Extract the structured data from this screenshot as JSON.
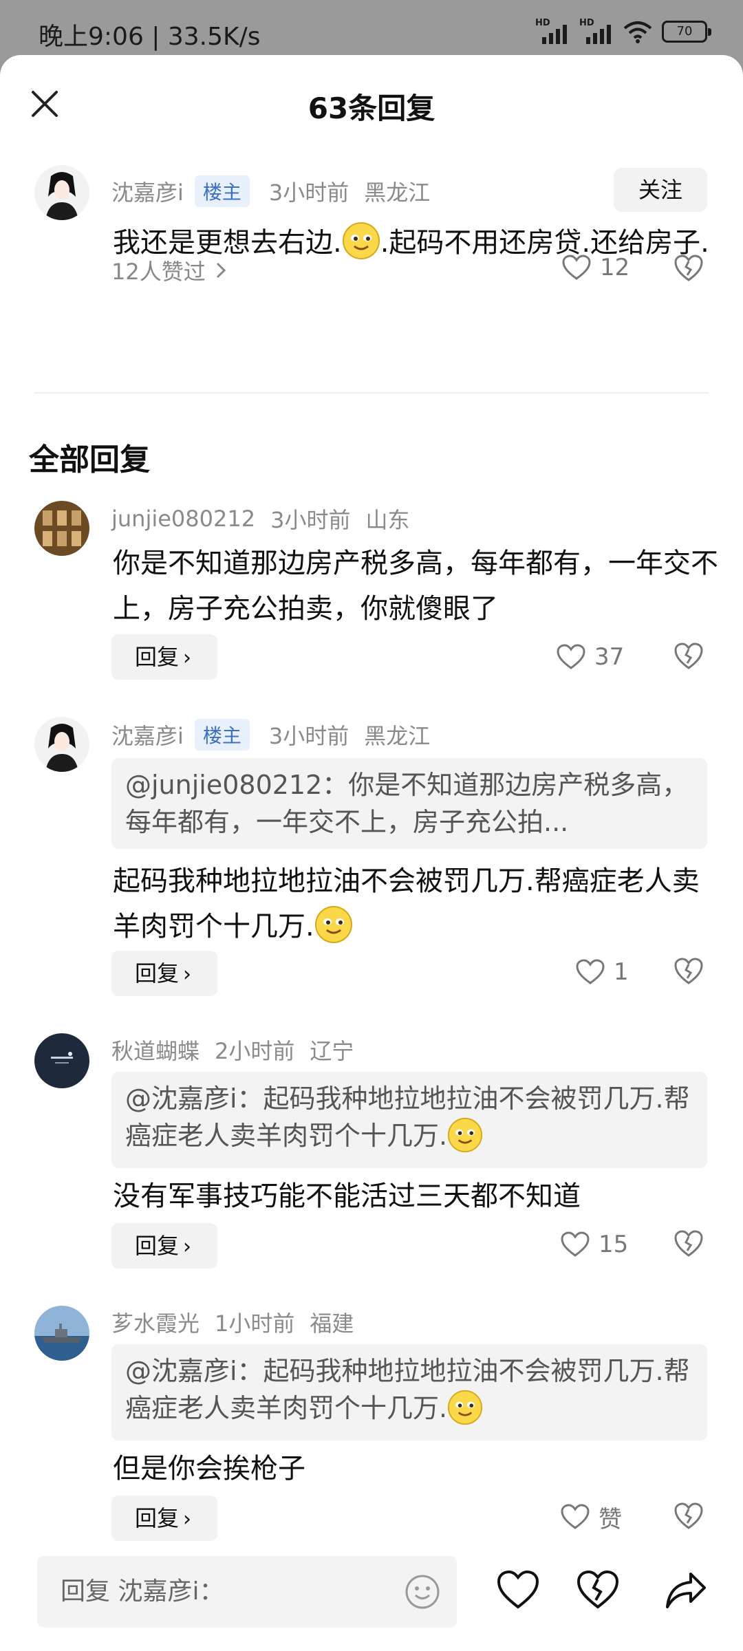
{
  "status": {
    "time": "晚上9:06 | 33.5K/s",
    "sig1": "HD",
    "sig2": "HD",
    "battery": "70"
  },
  "header": {
    "title": "63条回复"
  },
  "main_comment": {
    "author": "沈嘉彦i",
    "badge": "楼主",
    "time": "3小时前",
    "location": "黑龙江",
    "follow_label": "关注",
    "text_a": "我还是更想去右边.",
    "text_b": ".起码不用还房贷.还给房子.",
    "likers": "12人赞过",
    "likes": "12"
  },
  "section_title": "全部回复",
  "replies": [
    {
      "author": "junjie080212",
      "time": "3小时前",
      "location": "山东",
      "text": "你是不知道那边房产税多高，每年都有，一年交不上，房子充公拍卖，你就傻眼了",
      "reply_label": "回复",
      "likes": "37"
    },
    {
      "author": "沈嘉彦i",
      "badge": "楼主",
      "time": "3小时前",
      "location": "黑龙江",
      "quote": "@junjie080212：你是不知道那边房产税多高，每年都有，一年交不上，房子充公拍...",
      "text": "起码我种地拉地拉油不会被罚几万.帮癌症老人卖羊肉罚个十几万.",
      "reply_label": "回复",
      "likes": "1"
    },
    {
      "author": "秋道蝴蝶",
      "time": "2小时前",
      "location": "辽宁",
      "quote": "@沈嘉彦i：起码我种地拉地拉油不会被罚几万.帮癌症老人卖羊肉罚个十几万.",
      "text": "没有军事技巧能不能活过三天都不知道",
      "reply_label": "回复",
      "likes": "15"
    },
    {
      "author": "芗水霞光",
      "time": "1小时前",
      "location": "福建",
      "quote": "@沈嘉彦i：起码我种地拉地拉油不会被罚几万.帮癌症老人卖羊肉罚个十几万.",
      "text": "但是你会挨枪子",
      "reply_label": "回复",
      "likes": "赞"
    }
  ],
  "composer": {
    "placeholder": "回复 沈嘉彦i："
  }
}
